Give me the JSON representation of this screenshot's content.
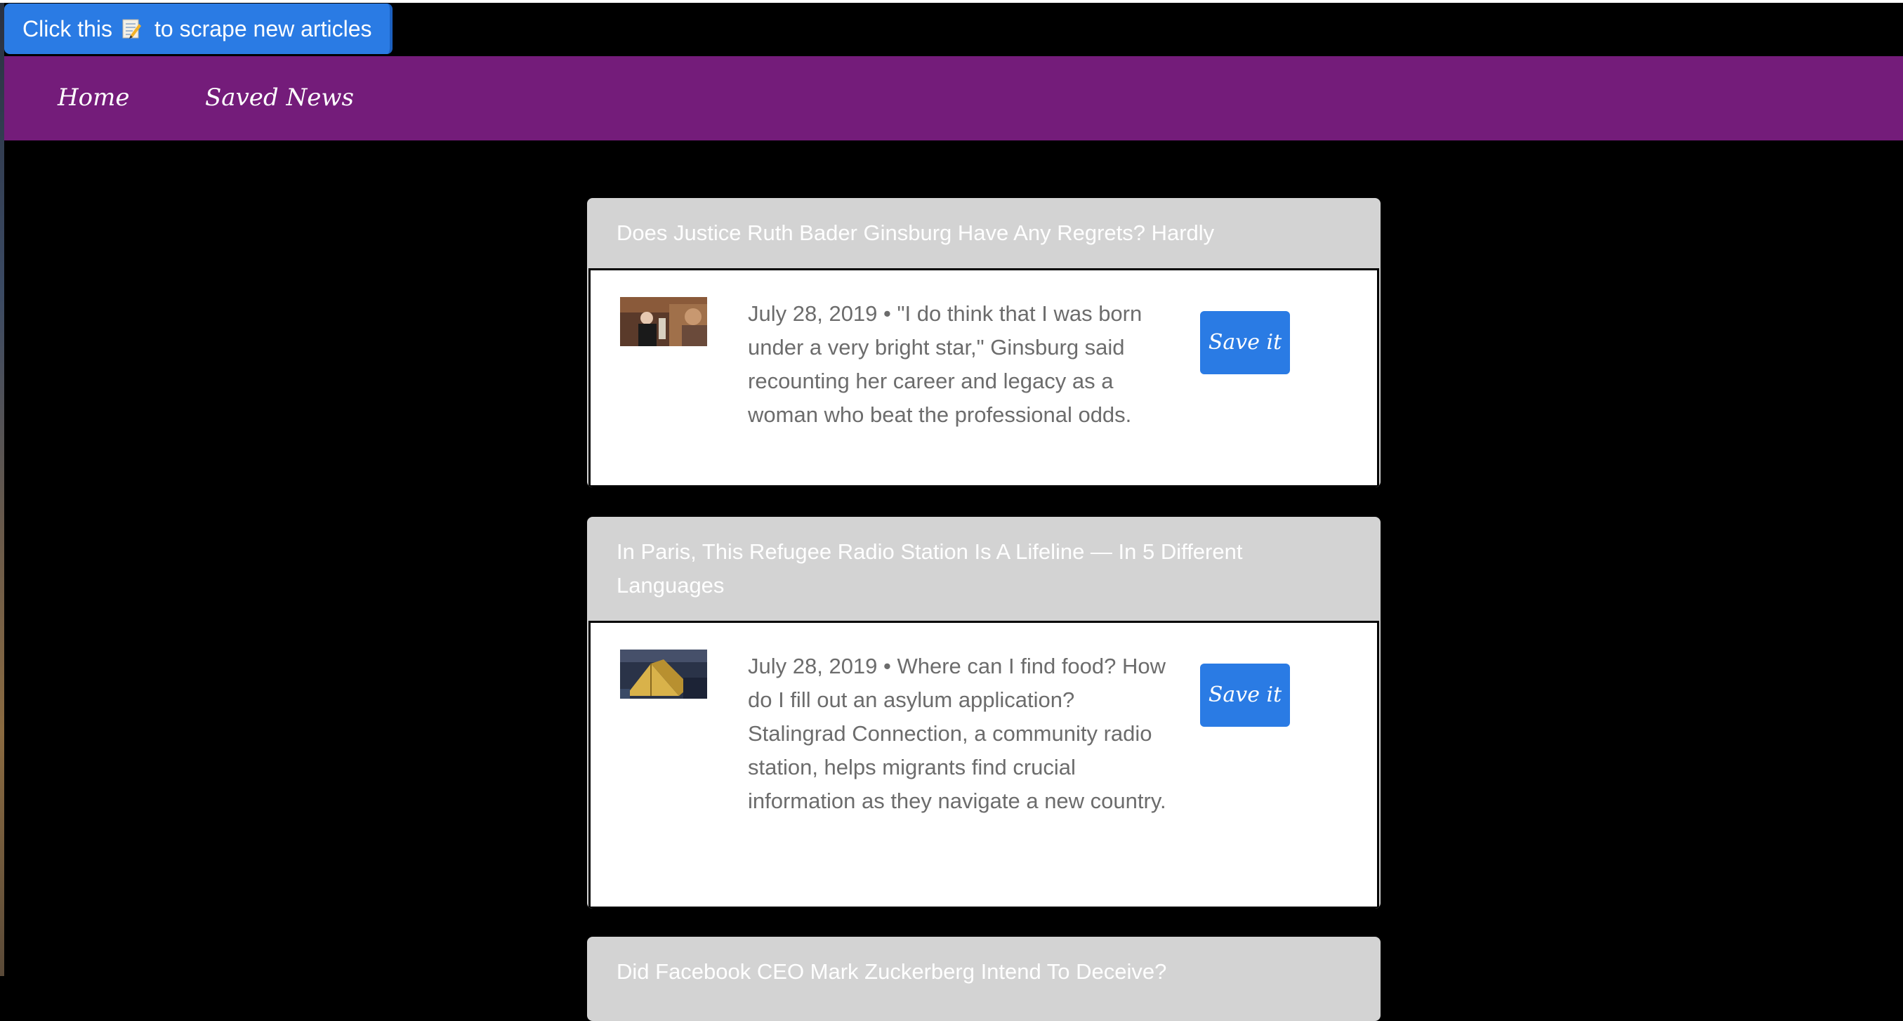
{
  "scrape_button": {
    "label_before": "Click this",
    "icon": "memo-icon",
    "label_after": "to scrape new articles"
  },
  "nav": {
    "home": "Home",
    "saved": "Saved News"
  },
  "articles": [
    {
      "title": "Does Justice Ruth Bader Ginsburg Have Any Regrets? Hardly",
      "summary": "July 28, 2019 • \"I do think that I was born under a very bright star,\" Ginsburg said recounting her career and legacy as a woman who beat the professional odds.",
      "save_label": "Save it",
      "thumb_icon": "photo-ginsburg"
    },
    {
      "title": "In Paris, This Refugee Radio Station Is A Lifeline — In 5 Different Languages",
      "summary": "July 28, 2019 • Where can I find food? How do I fill out an asylum application? Stalingrad Connection, a community radio station, helps migrants find crucial information as they navigate a new country.",
      "save_label": "Save it",
      "thumb_icon": "photo-tents"
    },
    {
      "title": "Did Facebook CEO Mark Zuckerberg Intend To Deceive?"
    }
  ],
  "colors": {
    "navbar": "#741c7a",
    "button": "#2a7be4",
    "card_header": "#d3d3d3",
    "background": "#000000"
  }
}
